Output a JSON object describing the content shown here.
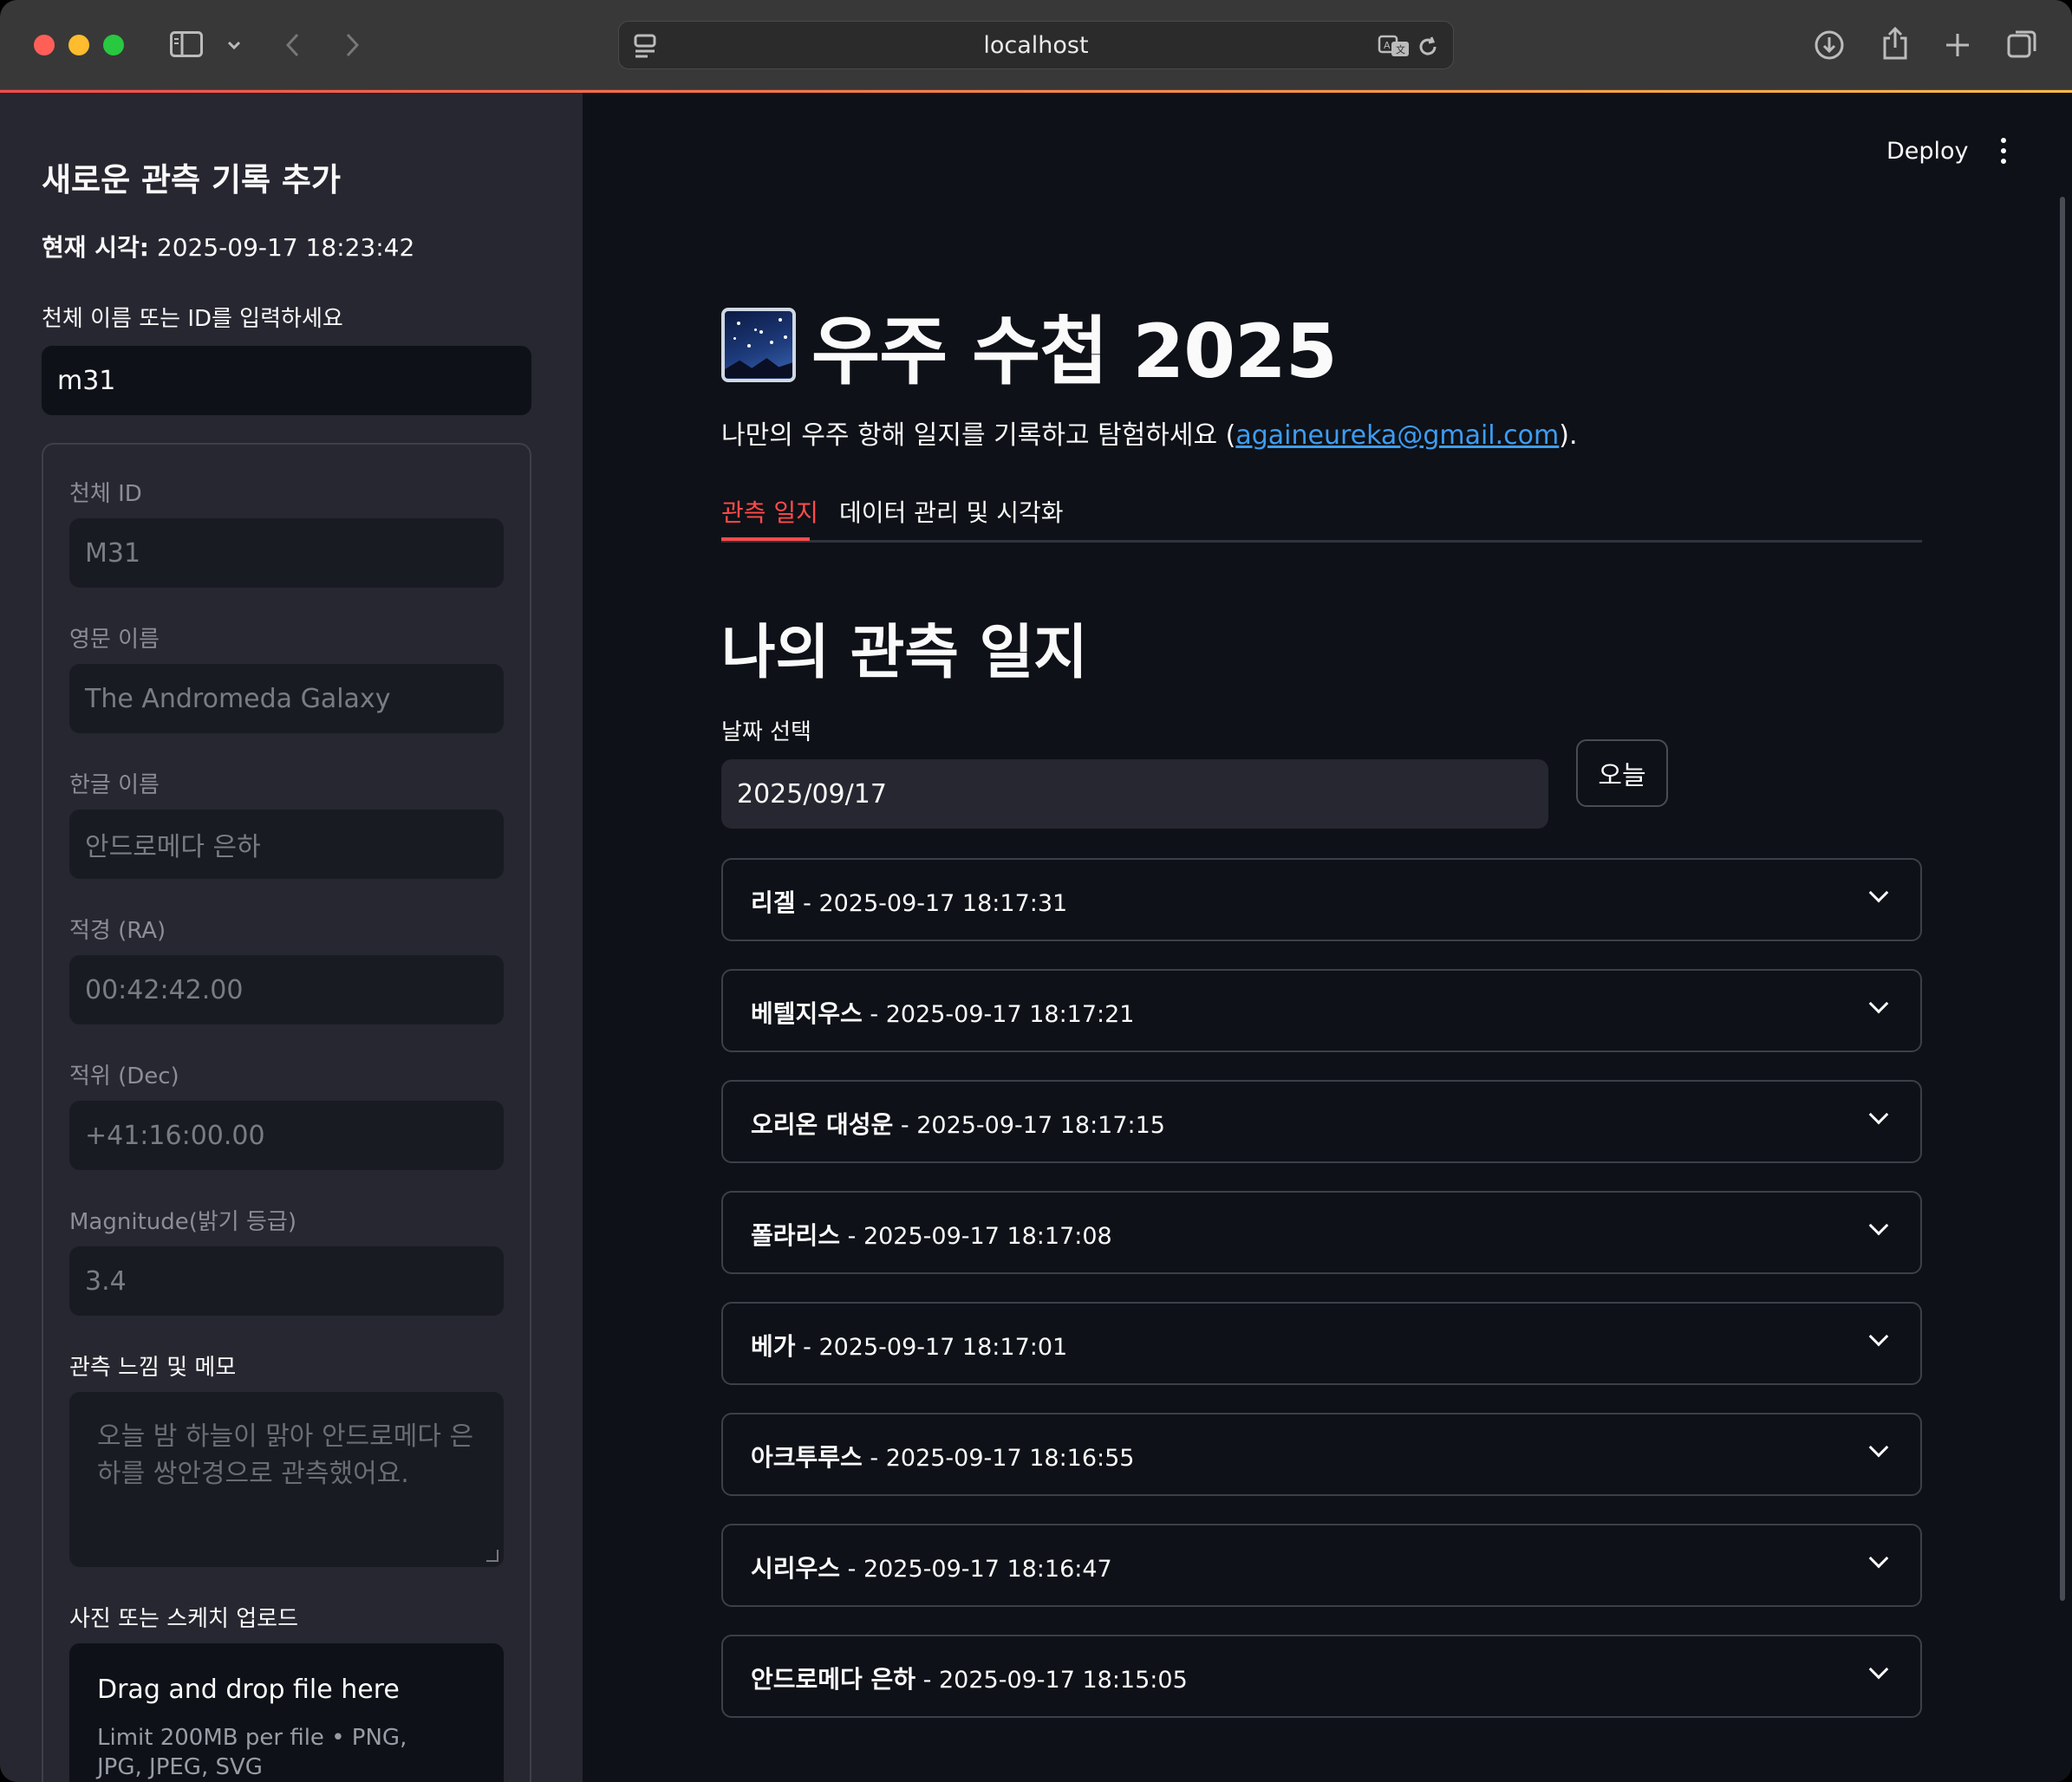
{
  "browser": {
    "url": "localhost"
  },
  "sidebar": {
    "title": "새로운 관측 기록 추가",
    "current_time_label": "현재 시각:",
    "current_time_value": "2025-09-17 18:23:42",
    "search_label": "천체 이름 또는 ID를 입력하세요",
    "search_value": "m31",
    "fields": [
      {
        "label": "천체 ID",
        "value": "M31"
      },
      {
        "label": "영문 이름",
        "value": "The Andromeda Galaxy"
      },
      {
        "label": "한글 이름",
        "value": "안드로메다 은하"
      },
      {
        "label": "적경 (RA)",
        "value": "00:42:42.00"
      },
      {
        "label": "적위 (Dec)",
        "value": "+41:16:00.00"
      },
      {
        "label": "Magnitude(밝기 등급)",
        "value": "3.4"
      }
    ],
    "memo_label": "관측 느낌 및 메모",
    "memo_placeholder": "오늘 밤 하늘이 맑아 안드로메다 은하를 쌍안경으로 관측했어요.",
    "upload_label": "사진 또는 스케치 업로드",
    "upload_title": "Drag and drop file here",
    "upload_limit": "Limit 200MB per file • PNG, JPG, JPEG, SVG"
  },
  "main": {
    "deploy_label": "Deploy",
    "title": "우주 수첩 2025",
    "subtitle_prefix": "나만의 우주 항해 일지를 기록하고 탐험하세요 (",
    "subtitle_email": "againeureka@gmail.com",
    "subtitle_suffix": ").",
    "tabs": [
      {
        "label": "관측 일지",
        "active": true
      },
      {
        "label": "데이터 관리 및 시각화",
        "active": false
      }
    ],
    "section_title": "나의 관측 일지",
    "date_label": "날짜 선택",
    "date_value": "2025/09/17",
    "today_button": "오늘",
    "entries": [
      {
        "name": "리겔",
        "time": " - 2025-09-17 18:17:31"
      },
      {
        "name": "베텔지우스",
        "time": " - 2025-09-17 18:17:21"
      },
      {
        "name": "오리온 대성운",
        "time": " - 2025-09-17 18:17:15"
      },
      {
        "name": "폴라리스",
        "time": " - 2025-09-17 18:17:08"
      },
      {
        "name": "베가",
        "time": " - 2025-09-17 18:17:01"
      },
      {
        "name": "아크투루스",
        "time": " - 2025-09-17 18:16:55"
      },
      {
        "name": "시리우스",
        "time": " - 2025-09-17 18:16:47"
      },
      {
        "name": "안드로메다 은하",
        "time": " - 2025-09-17 18:15:05"
      }
    ]
  },
  "colors": {
    "accent": "#ff4b4b",
    "link": "#3d9df3",
    "sidebar_bg": "#262730",
    "main_bg": "#0e1117"
  }
}
